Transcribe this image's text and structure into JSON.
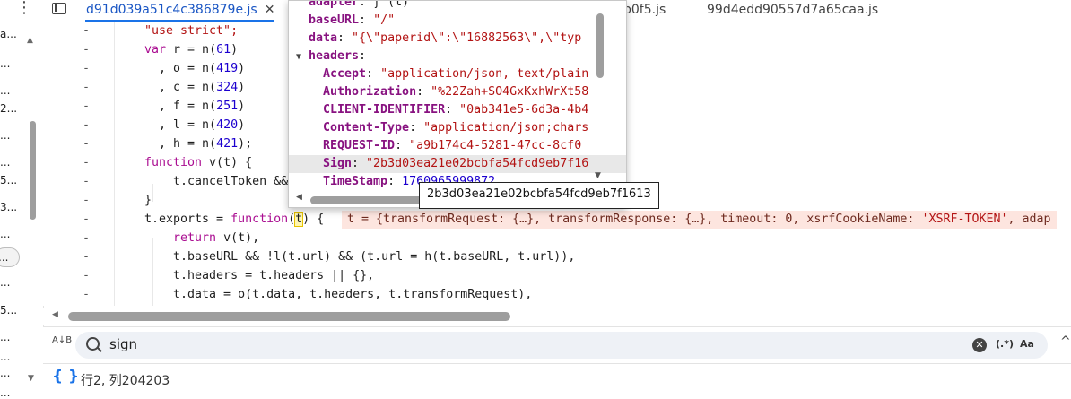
{
  "left_nav": {
    "items": [
      "a...",
      "...",
      "...",
      "2...",
      "...",
      "...",
      "5...",
      "3...",
      "...",
      "...",
      "5...",
      "...",
      "...",
      "...",
      "..."
    ],
    "pill_label": "..."
  },
  "tabs": {
    "active": "d91d039a51c4c386879e.js",
    "close_label": "✕",
    "others": [
      "b0f5.js",
      "99d4edd90557d7a65caa.js"
    ]
  },
  "code_lines": [
    {
      "gutter": "-",
      "tokens": [
        {
          "t": "\"use strict\";",
          "c": "str"
        }
      ]
    },
    {
      "gutter": "-",
      "tokens": [
        {
          "t": "var",
          "c": "kw"
        },
        {
          "t": " r = n(",
          "c": "tok"
        },
        {
          "t": "61",
          "c": "num"
        },
        {
          "t": ")",
          "c": "tok"
        }
      ]
    },
    {
      "gutter": "-",
      "tokens": [
        {
          "t": "  , o = n(",
          "c": "tok"
        },
        {
          "t": "419",
          "c": "num"
        },
        {
          "t": ")",
          "c": "tok"
        }
      ]
    },
    {
      "gutter": "-",
      "tokens": [
        {
          "t": "  , c = n(",
          "c": "tok"
        },
        {
          "t": "324",
          "c": "num"
        },
        {
          "t": ")",
          "c": "tok"
        }
      ]
    },
    {
      "gutter": "-",
      "tokens": [
        {
          "t": "  , f = n(",
          "c": "tok"
        },
        {
          "t": "251",
          "c": "num"
        },
        {
          "t": ")",
          "c": "tok"
        }
      ]
    },
    {
      "gutter": "-",
      "tokens": [
        {
          "t": "  , l = n(",
          "c": "tok"
        },
        {
          "t": "420",
          "c": "num"
        },
        {
          "t": ")",
          "c": "tok"
        }
      ]
    },
    {
      "gutter": "-",
      "tokens": [
        {
          "t": "  , h = n(",
          "c": "tok"
        },
        {
          "t": "421",
          "c": "num"
        },
        {
          "t": ");",
          "c": "tok"
        }
      ]
    },
    {
      "gutter": "-",
      "tokens": [
        {
          "t": "function",
          "c": "kw"
        },
        {
          "t": " v(t) {",
          "c": "tok"
        }
      ]
    },
    {
      "gutter": "-",
      "tokens": [
        {
          "t": "    t.cancelToken &&",
          "c": "tok"
        }
      ]
    },
    {
      "gutter": "-",
      "tokens": [
        {
          "t": "}",
          "c": "tok"
        }
      ]
    },
    {
      "gutter": "-",
      "tokens": [
        {
          "t": "t.exports = ",
          "c": "tok"
        },
        {
          "t": "function",
          "c": "kw"
        },
        {
          "t": "(",
          "c": "tok"
        },
        {
          "t": "t",
          "c": "hl"
        },
        {
          "t": ") {",
          "c": "tok"
        }
      ]
    },
    {
      "gutter": "-",
      "tokens": [
        {
          "t": "    ",
          "c": "tok"
        },
        {
          "t": "return",
          "c": "kw"
        },
        {
          "t": " v(t),",
          "c": "tok"
        }
      ]
    },
    {
      "gutter": "-",
      "tokens": [
        {
          "t": "    t.baseURL && !l(t.url) && (t.url = h(t.baseURL, t.url)),",
          "c": "tok"
        }
      ]
    },
    {
      "gutter": "-",
      "tokens": [
        {
          "t": "    t.headers = t.headers || {},",
          "c": "tok"
        }
      ]
    },
    {
      "gutter": "-",
      "tokens": [
        {
          "t": "    t.data = o(t.data, t.headers, t.transformRequest),",
          "c": "tok"
        }
      ]
    }
  ],
  "inline_preview": {
    "prefix": "t = {transformRequest: {…}, transformResponse: {…}, timeout: 0, xsrfCookieName: ",
    "str": "'XSRF-TOKEN'",
    "suffix": ", adap"
  },
  "popover": {
    "rows": [
      {
        "key": "adapter",
        "val": "ƒ (t)",
        "indent": 0,
        "kind": "fn"
      },
      {
        "key": "baseURL",
        "val": "\"/\"",
        "indent": 0,
        "kind": "str"
      },
      {
        "key": "data",
        "val": "\"{\\\"paperid\\\":\\\"16882563\\\",\\\"typ",
        "indent": 0,
        "kind": "str"
      },
      {
        "key": "headers",
        "val": "",
        "indent": 0,
        "kind": "obj"
      },
      {
        "key": "Accept",
        "val": "\"application/json, text/plain",
        "indent": 1,
        "kind": "str"
      },
      {
        "key": "Authorization",
        "val": "\"%22Zah+SO4GxKxhWrXt58",
        "indent": 1,
        "kind": "str"
      },
      {
        "key": "CLIENT-IDENTIFIER",
        "val": "\"0ab341e5-6d3a-4b4",
        "indent": 1,
        "kind": "str"
      },
      {
        "key": "Content-Type",
        "val": "\"application/json;chars",
        "indent": 1,
        "kind": "str"
      },
      {
        "key": "REQUEST-ID",
        "val": "\"a9b174c4-5281-47cc-8cf0",
        "indent": 1,
        "kind": "str"
      },
      {
        "key": "Sign",
        "val": "\"2b3d03ea21e02bcbfa54fcd9eb7f16",
        "indent": 1,
        "kind": "str",
        "selected": true
      },
      {
        "key": "TimeStamp",
        "val": "1760965999872",
        "indent": 1,
        "kind": "num"
      }
    ]
  },
  "tooltip": {
    "text": "2b3d03ea21e02bcbfa54fcd9eb7f1613"
  },
  "search": {
    "query": "sign",
    "clear_label": "✕",
    "regex_label": "(.*)",
    "case_label": "Aa",
    "replace_toggle": "A↓B"
  },
  "status": {
    "braces": "{ }",
    "position": "行2, 列204203"
  }
}
